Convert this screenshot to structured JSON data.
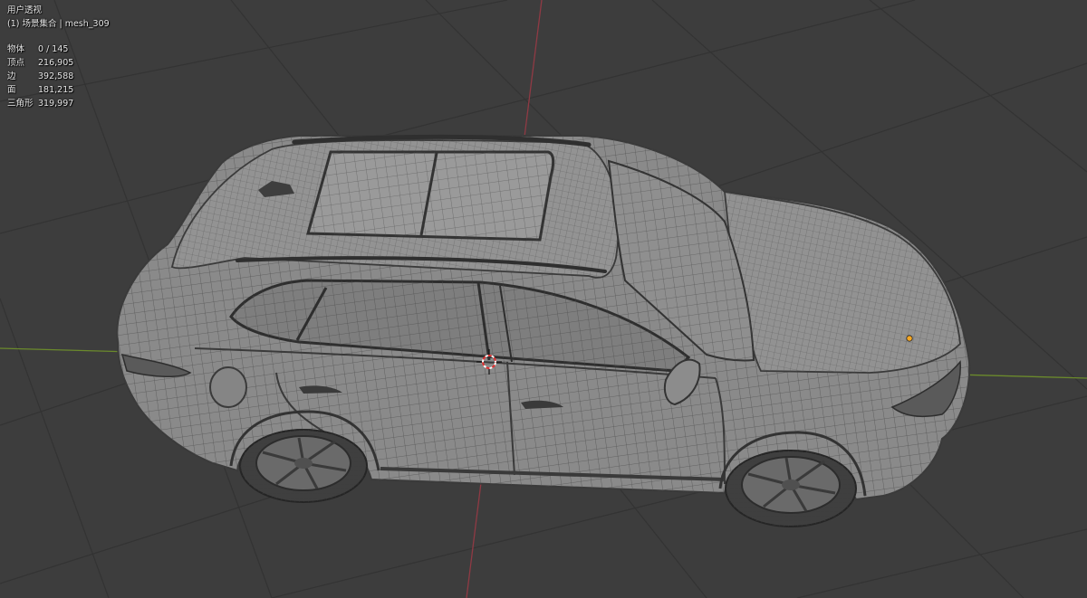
{
  "viewport": {
    "view_name": "用户透视",
    "collection_line": "(1) 场景集合 | mesh_309",
    "stats": [
      {
        "label": "物体",
        "value": "0 / 145"
      },
      {
        "label": "顶点",
        "value": "216,905"
      },
      {
        "label": "边",
        "value": "392,588"
      },
      {
        "label": "面",
        "value": "181,215"
      },
      {
        "label": "三角形",
        "value": "319,997"
      }
    ]
  },
  "colors": {
    "background": "#3d3d3d",
    "grid_line": "#333333",
    "x_axis": "#8f3a44",
    "y_axis": "#6b8a2c",
    "mesh_fill": "#8a8a8a",
    "wire": "#4a4a4a",
    "origin_dot": "#f5a623"
  }
}
